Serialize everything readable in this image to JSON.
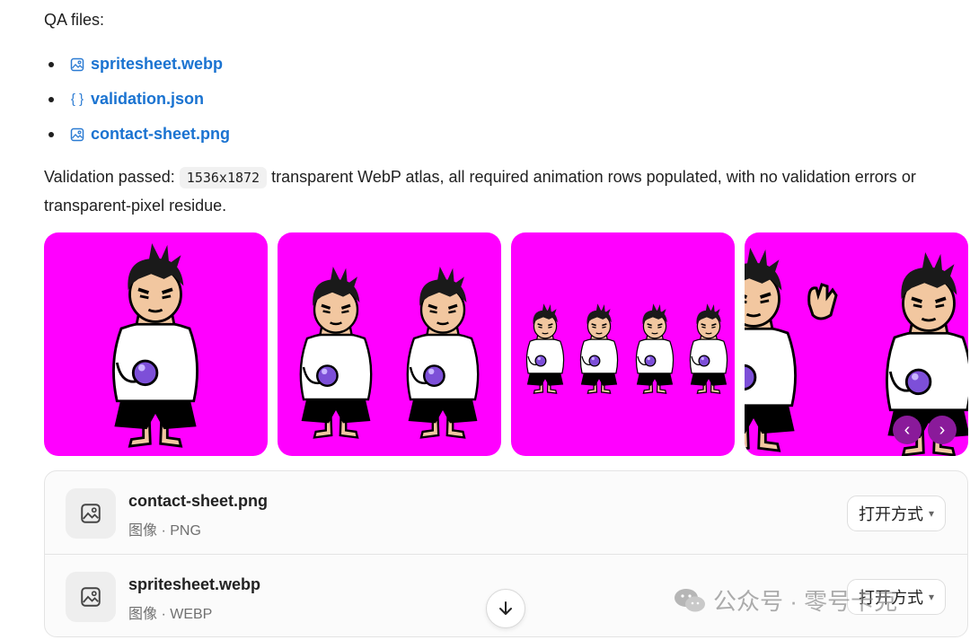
{
  "qa_heading": "QA files:",
  "files": [
    {
      "label": "spritesheet.webp",
      "icon": "image-icon"
    },
    {
      "label": "validation.json",
      "icon": "json-braces-icon",
      "glyph": "{ }"
    },
    {
      "label": "contact-sheet.png",
      "icon": "image-icon"
    }
  ],
  "validation": {
    "prefix": "Validation passed:",
    "code": "1536x1872",
    "suffix": "transparent WebP atlas, all required animation rows populated, with no validation errors or transparent-pixel residue."
  },
  "gallery": {
    "prev_glyph": "‹",
    "next_glyph": "›",
    "background_color": "#ff00ff"
  },
  "attachments": [
    {
      "name": "contact-sheet.png",
      "meta": "图像 · PNG",
      "open_label": "打开方式"
    },
    {
      "name": "spritesheet.webp",
      "meta": "图像 · WEBP",
      "open_label": "打开方式"
    }
  ],
  "watermark": {
    "text": "公众号 · 零号卡克",
    "icon": "wechat-icon"
  },
  "colors": {
    "link": "#1a73d1",
    "accent": "#8a1a9a"
  }
}
